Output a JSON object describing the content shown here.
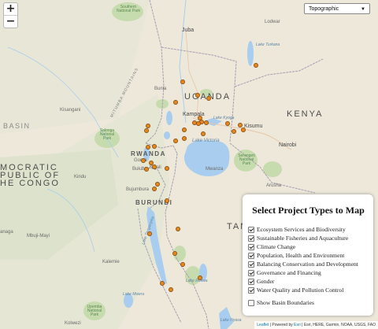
{
  "map": {
    "labels": {
      "uganda": "UGANDA",
      "kenya": "KENYA",
      "rwanda": "RWANDA",
      "burundi": "BURUNDI",
      "tanzania": "TAN",
      "drc_1": "MOCRATIC",
      "drc_2": "PUBLIC OF",
      "drc_3": "HE CONGO",
      "juba": "Juba",
      "kampala": "Kampala",
      "kisumu": "Kisumu",
      "nairobi": "Nairobi",
      "arusha": "Arusha",
      "mwanza": "Mwanza",
      "kigali": "Kigali",
      "bukavu": "Bukavu",
      "goma": "Goma",
      "bujumbura": "Bujumbura",
      "kindu": "Kindu",
      "kisangani": "Kisangani",
      "bunia": "Bunia",
      "lodwar": "Lodwar",
      "mbuji_mayi": "Mbuji-Mayi",
      "kalemie": "Kalemie",
      "kolwezi": "Kolwezi",
      "kanaga": "anaga",
      "basin": "BASIN",
      "mitumba": "MITUMBA MOUNTAINS",
      "lake_victoria": "Lake Victoria",
      "lake_tanganyika": "Lake Tanganyika",
      "lake_turkana": "Lake Turkana",
      "lake_kyoga": "Lake Kyoga",
      "lake_rukwa": "Lake Rukwa",
      "lake_malawi": "Lake Nyasa",
      "lake_mweru": "Lake Mweru",
      "park_salonga": "Salonga National Park",
      "park_serengeti": "Serengeti National Park",
      "park_southern": "Southern National Park",
      "park_upemba": "Upemba National Park"
    }
  },
  "controls": {
    "zoom_in": "+",
    "zoom_out": "−",
    "basemap_selected": "Topographic",
    "basemap_arrow": "▼"
  },
  "panel": {
    "title": "Select Project Types to Map",
    "options": [
      {
        "label": "Ecosystem Services and Biodiversity",
        "checked": true
      },
      {
        "label": "Sustainable Fisheries and Aquaculture",
        "checked": true
      },
      {
        "label": "Climate Change",
        "checked": true
      },
      {
        "label": "Population, Health and Environment",
        "checked": true
      },
      {
        "label": "Balancing Conservation and Development",
        "checked": true
      },
      {
        "label": "Governance and Financing",
        "checked": true
      },
      {
        "label": "Gender",
        "checked": true
      },
      {
        "label": "Water Quality and Pollution Control",
        "checked": true
      }
    ],
    "basin_toggle": {
      "label": "Show Basin Boundaries",
      "checked": false
    }
  },
  "attribution": {
    "leaflet": "Leaflet",
    "sep": " | Powered by ",
    "esri": "Esri",
    "rest": " | Esri, HERE, Garmin, NOAA, USGS, FAO"
  },
  "colors": {
    "marker_fill": "#e3861d",
    "marker_stroke": "#7a4108",
    "water": "#a9cdee",
    "land": "#ede8da",
    "park": "#c7dcae"
  }
}
